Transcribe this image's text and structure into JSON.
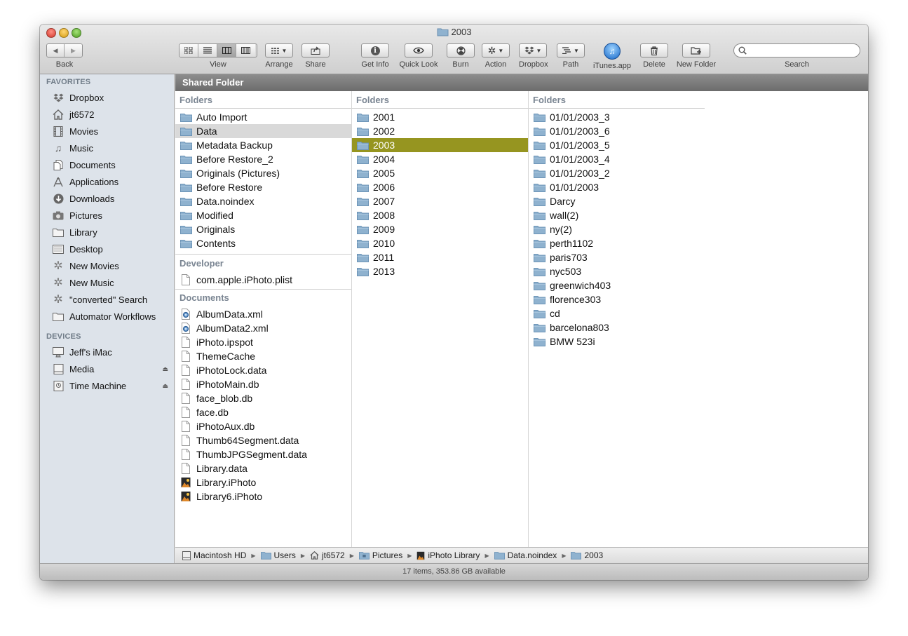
{
  "window": {
    "title": "2003"
  },
  "toolbar": {
    "back_label": "Back",
    "view_label": "View",
    "arrange_label": "Arrange",
    "share_label": "Share",
    "getinfo_label": "Get Info",
    "quicklook_label": "Quick Look",
    "burn_label": "Burn",
    "action_label": "Action",
    "dropbox_label": "Dropbox",
    "path_label": "Path",
    "itunes_label": "iTunes.app",
    "delete_label": "Delete",
    "newfolder_label": "New Folder",
    "search_label": "Search",
    "search_placeholder": ""
  },
  "sidebar": {
    "favorites_header": "FAVORITES",
    "favorites": [
      {
        "label": "Dropbox",
        "icon": "dropbox-icon"
      },
      {
        "label": "jt6572",
        "icon": "home-icon"
      },
      {
        "label": "Movies",
        "icon": "film-icon"
      },
      {
        "label": "Music",
        "icon": "music-note-icon"
      },
      {
        "label": "Documents",
        "icon": "documents-icon"
      },
      {
        "label": "Applications",
        "icon": "applications-icon"
      },
      {
        "label": "Downloads",
        "icon": "download-icon"
      },
      {
        "label": "Pictures",
        "icon": "camera-icon"
      },
      {
        "label": "Library",
        "icon": "folder-icon"
      },
      {
        "label": "Desktop",
        "icon": "desktop-icon"
      },
      {
        "label": "New Movies",
        "icon": "smart-folder-gear-icon"
      },
      {
        "label": "New Music",
        "icon": "smart-folder-gear-icon"
      },
      {
        "label": "\"converted\" Search",
        "icon": "smart-folder-gear-icon"
      },
      {
        "label": "Automator Workflows",
        "icon": "folder-icon"
      }
    ],
    "devices_header": "DEVICES",
    "devices": [
      {
        "label": "Jeff's iMac",
        "icon": "imac-icon"
      },
      {
        "label": "Media",
        "icon": "drive-icon"
      },
      {
        "label": "Time Machine",
        "icon": "time-machine-drive-icon"
      }
    ]
  },
  "header_bar": {
    "title": "Shared Folder"
  },
  "columns": {
    "col1": {
      "folders_header": "Folders",
      "folders": [
        "Auto Import",
        "Data",
        "Metadata Backup",
        "Before Restore_2",
        "Originals (Pictures)",
        "Before Restore",
        "Data.noindex",
        "Modified",
        "Originals",
        "Contents"
      ],
      "developer_header": "Developer",
      "developer": [
        "com.apple.iPhoto.plist"
      ],
      "documents_header": "Documents",
      "documents": [
        {
          "label": "AlbumData.xml",
          "icon": "xml-file-icon"
        },
        {
          "label": "AlbumData2.xml",
          "icon": "xml-file-icon"
        },
        {
          "label": "iPhoto.ipspot",
          "icon": "file-icon"
        },
        {
          "label": "ThemeCache",
          "icon": "file-icon"
        },
        {
          "label": "iPhotoLock.data",
          "icon": "file-icon"
        },
        {
          "label": "iPhotoMain.db",
          "icon": "file-icon"
        },
        {
          "label": "face_blob.db",
          "icon": "file-icon"
        },
        {
          "label": "face.db",
          "icon": "file-icon"
        },
        {
          "label": "iPhotoAux.db",
          "icon": "file-icon"
        },
        {
          "label": "Thumb64Segment.data",
          "icon": "file-icon"
        },
        {
          "label": "ThumbJPGSegment.data",
          "icon": "file-icon"
        },
        {
          "label": "Library.data",
          "icon": "file-icon"
        },
        {
          "label": "Library.iPhoto",
          "icon": "iphoto-file-icon"
        },
        {
          "label": "Library6.iPhoto",
          "icon": "iphoto-file-icon"
        }
      ]
    },
    "col2": {
      "folders_header": "Folders",
      "folders": [
        "2001",
        "2002",
        "2003",
        "2004",
        "2005",
        "2006",
        "2007",
        "2008",
        "2009",
        "2010",
        "2011",
        "2013"
      ]
    },
    "col3": {
      "folders_header": "Folders",
      "folders": [
        "01/01/2003_3",
        "01/01/2003_6",
        "01/01/2003_5",
        "01/01/2003_4",
        "01/01/2003_2",
        "01/01/2003",
        "Darcy",
        "wall(2)",
        "ny(2)",
        "perth1102",
        "paris703",
        "nyc503",
        "greenwich403",
        "florence303",
        "cd",
        "barcelona803",
        "BMW 523i"
      ]
    }
  },
  "path_bar": [
    "Macintosh HD",
    "Users",
    "jt6572",
    "Pictures",
    "iPhoto Library",
    "Data.noindex",
    "2003"
  ],
  "status_bar": {
    "text": "17 items, 353.86 GB available"
  },
  "colors": {
    "selection_olive": "#969520",
    "selection_grey": "#d9d9d9",
    "sidebar_bg": "#dde3ea",
    "folder_blue": "#8fb2cf"
  }
}
